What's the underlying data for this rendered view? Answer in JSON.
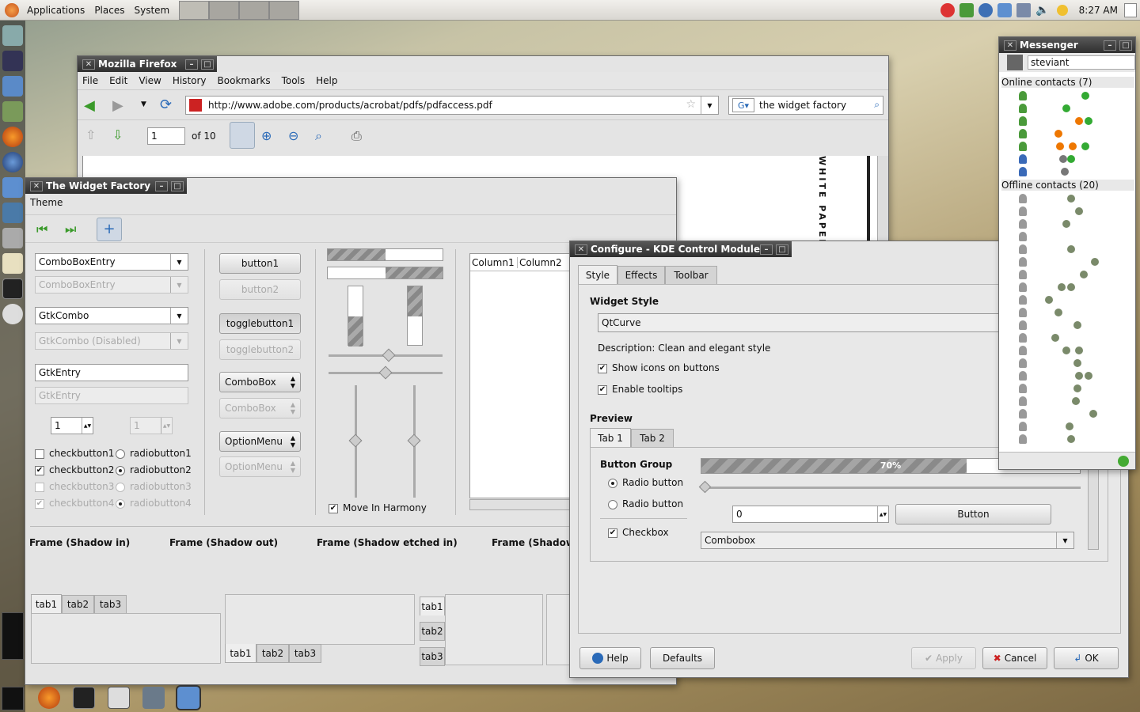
{
  "panel": {
    "menus": [
      "Applications",
      "Places",
      "System"
    ],
    "clock": "8:27 AM"
  },
  "firefox": {
    "title": "Mozilla Firefox",
    "menus": [
      "File",
      "Edit",
      "View",
      "History",
      "Bookmarks",
      "Tools",
      "Help"
    ],
    "url": "http://www.adobe.com/products/acrobat/pdfs/pdfaccess.pdf",
    "search": "the widget factory",
    "page": "1",
    "of": "of 10",
    "doc_text": "WHITE PAPER"
  },
  "wf": {
    "title": "The Widget Factory",
    "menu": "Theme",
    "combo1": "ComboBoxEntry",
    "combo1d": "ComboBoxEntry",
    "combo2": "GtkCombo",
    "combo2d": "GtkCombo (Disabled)",
    "entry": "GtkEntry",
    "entryd": "GtkEntry",
    "spin1": "1",
    "spin2": "1",
    "checks": [
      "checkbutton1",
      "checkbutton2",
      "checkbutton3",
      "checkbutton4"
    ],
    "radios": [
      "radiobutton1",
      "radiobutton2",
      "radiobutton3",
      "radiobutton4"
    ],
    "buttons": [
      "button1",
      "button2",
      "togglebutton1",
      "togglebutton2",
      "ComboBox",
      "ComboBox",
      "OptionMenu",
      "OptionMenu"
    ],
    "harmony": "Move In Harmony",
    "col1": "Column1",
    "col2": "Column2",
    "frames": [
      "Frame (Shadow in)",
      "Frame (Shadow out)",
      "Frame (Shadow etched in)",
      "Frame (Shadow e"
    ],
    "tabs": [
      "tab1",
      "tab2",
      "tab3"
    ]
  },
  "kde": {
    "title": "Configure - KDE Control Module",
    "tabs": [
      "Style",
      "Effects",
      "Toolbar"
    ],
    "widget_style": "Widget Style",
    "style_value": "QtCurve",
    "description": "Description: Clean and elegant style",
    "show_icons": "Show icons on buttons",
    "tooltips": "Enable tooltips",
    "preview": "Preview",
    "ptabs": [
      "Tab 1",
      "Tab 2"
    ],
    "group": "Button Group",
    "radio1": "Radio button",
    "radio2": "Radio button",
    "checkbox": "Checkbox",
    "progress": 70,
    "progress_label": "70%",
    "spin": "0",
    "button": "Button",
    "combobox": "Combobox",
    "help": "Help",
    "defaults": "Defaults",
    "apply": "Apply",
    "cancel": "Cancel",
    "ok": "OK"
  },
  "messenger": {
    "title": "Messenger",
    "user": "steviant",
    "online": "Online contacts (7)",
    "offline": "Offline contacts (20)"
  }
}
